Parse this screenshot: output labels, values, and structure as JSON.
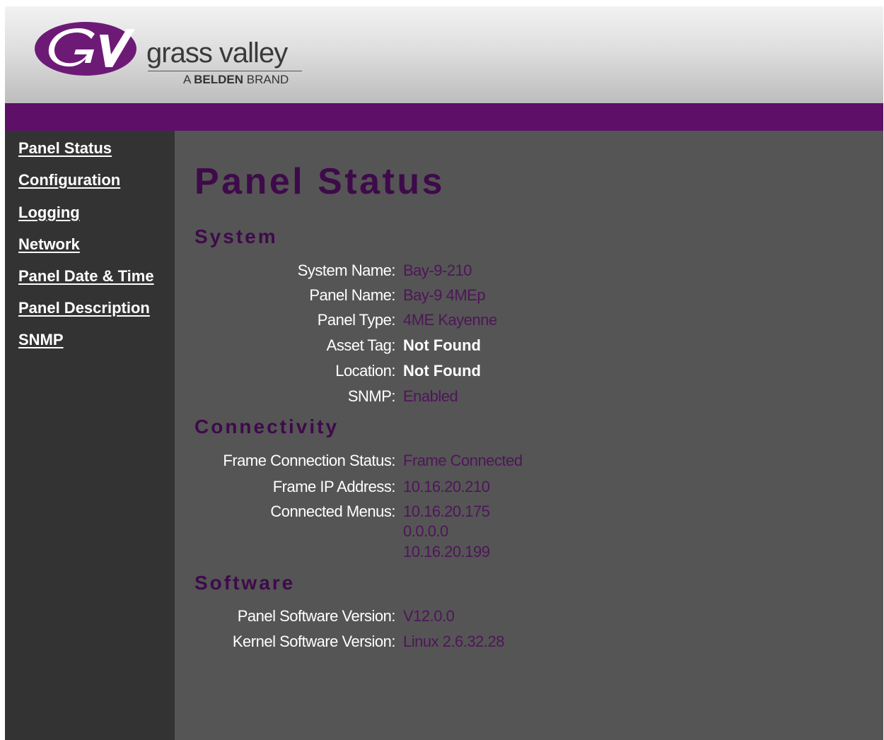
{
  "header": {
    "brand_name": "grass valley",
    "tagline_prefix": "A",
    "tagline_bold": "BELDEN",
    "tagline_suffix": "BRAND",
    "brand_color": "#5e0f67"
  },
  "nav": [
    {
      "label": "Panel Status"
    },
    {
      "label": "Configuration"
    },
    {
      "label": "Logging"
    },
    {
      "label": "Network"
    },
    {
      "label": "Panel Date & Time"
    },
    {
      "label": "Panel Description"
    },
    {
      "label": "SNMP"
    }
  ],
  "main": {
    "title": "Panel Status",
    "system": {
      "heading": "System",
      "system_name_label": "System Name:",
      "system_name_value": "Bay-9-210",
      "panel_name_label": "Panel Name:",
      "panel_name_value": "Bay-9 4MEp",
      "panel_type_label": "Panel Type:",
      "panel_type_value": "4ME Kayenne",
      "asset_tag_label": "Asset Tag:",
      "asset_tag_value": "Not Found",
      "location_label": "Location:",
      "location_value": "Not Found",
      "snmp_label": "SNMP:",
      "snmp_value": "Enabled"
    },
    "connectivity": {
      "heading": "Connectivity",
      "frame_status_label": "Frame Connection Status:",
      "frame_status_value": "Frame Connected",
      "frame_ip_label": "Frame IP Address:",
      "frame_ip_value": "10.16.20.210",
      "menus_label": "Connected Menus:",
      "menus": [
        "10.16.20.175",
        "0.0.0.0",
        "10.16.20.199"
      ]
    },
    "software": {
      "heading": "Software",
      "panel_sw_label": "Panel Software Version:",
      "panel_sw_value": "V12.0.0",
      "kernel_sw_label": "Kernel Software Version:",
      "kernel_sw_value": "Linux 2.6.32.28"
    }
  },
  "colors": {
    "accent": "#5e0f67",
    "heading": "#3e0a4a",
    "value": "#4e1658",
    "sidebar_bg": "#333333",
    "content_bg": "#555555"
  }
}
